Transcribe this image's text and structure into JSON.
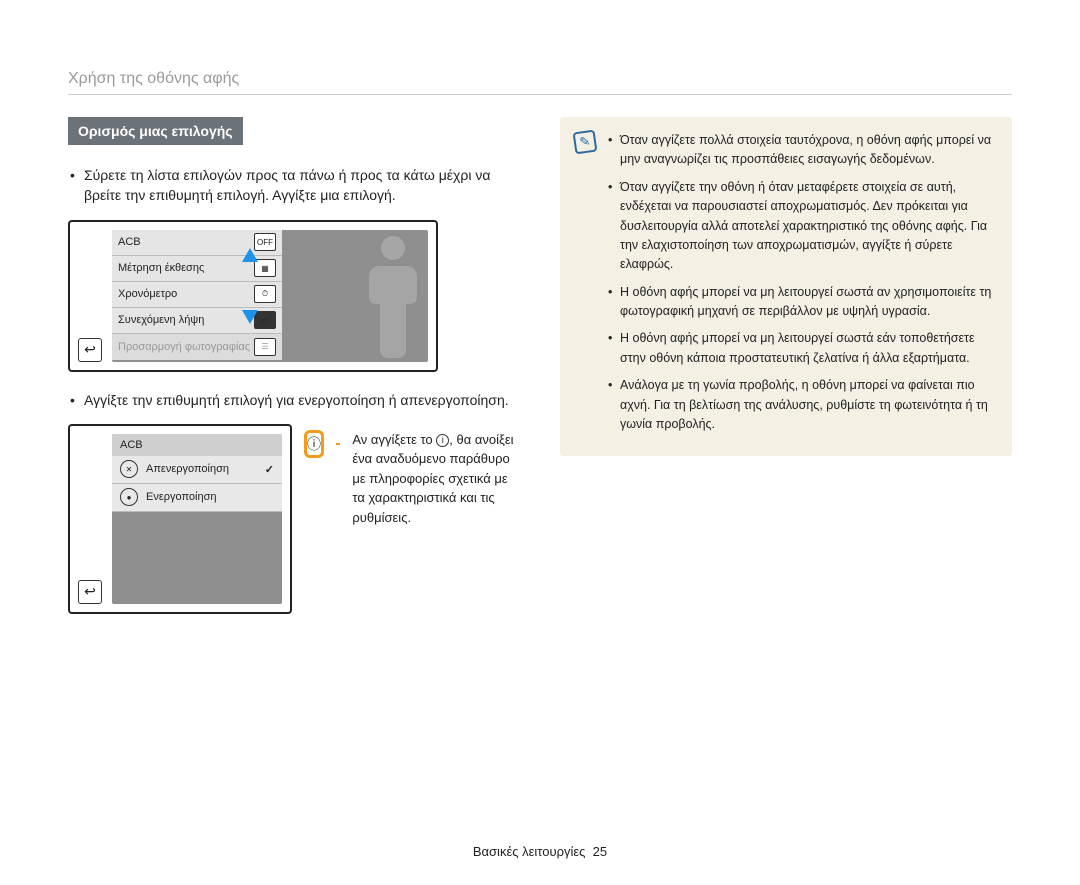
{
  "header": {
    "title": "Χρήση της οθόνης αφής"
  },
  "section": {
    "heading": "Ορισμός μιας επιλογής"
  },
  "paragraphs": {
    "scroll": "Σύρετε τη λίστα επιλογών προς τα πάνω ή προς τα κάτω μέχρι να βρείτε την επιθυμητή επιλογή. Αγγίξτε μια επιλογή.",
    "select": "Αγγίξτε την επιθυμητή επιλογή για ενεργοποίηση ή απενεργοποίηση."
  },
  "camera1": {
    "items": [
      "ACB",
      "Μέτρηση έκθεσης",
      "Χρονόμετρο",
      "Συνεχόμενη λήψη",
      "Προσαρμογή φωτογραφίας"
    ]
  },
  "camera2": {
    "head": "ACB",
    "off": "Απενεργοποίηση",
    "on": "Ενεργοποίηση"
  },
  "info": {
    "text": "Αν αγγίξετε το        , θα ανοίξει ένα αναδυόμενο παράθυρο με πληροφορίες σχετικά με τα χαρακτηριστικά και τις ρυθμίσεις.",
    "text_prefix": "Αν αγγίξετε το ",
    "text_suffix": ", θα ανοίξει ένα αναδυόμενο παράθυρο με πληροφορίες σχετικά με τα χαρακτηριστικά και τις ρυθμίσεις."
  },
  "notes": [
    "Όταν αγγίζετε πολλά στοιχεία ταυτόχρονα, η οθόνη αφής μπορεί να μην αναγνωρίζει τις προσπάθειες εισαγωγής δεδομένων.",
    "Όταν αγγίζετε την οθόνη ή όταν μεταφέρετε στοιχεία σε αυτή, ενδέχεται να παρουσιαστεί αποχρωματισμός. Δεν πρόκειται για δυσλειτουργία αλλά αποτελεί χαρακτηριστικό της οθόνης αφής. Για την ελαχιστοποίηση των αποχρωματισμών, αγγίξτε ή σύρετε ελαφρώς.",
    "Η οθόνη αφής μπορεί να μη λειτουργεί σωστά αν χρησιμοποιείτε τη φωτογραφική μηχανή σε περιβάλλον με υψηλή υγρασία.",
    "Η οθόνη αφής μπορεί να μη λειτουργεί σωστά εάν τοποθετήσετε στην οθόνη κάποια προστατευτική ζελατίνα ή άλλα εξαρτήματα.",
    "Ανάλογα με τη γωνία προβολής, η οθόνη μπορεί να φαίνεται πιο αχνή. Για τη βελτίωση της ανάλυσης, ρυθμίστε τη φωτεινότητα ή τη γωνία προβολής."
  ],
  "footer": {
    "chapter": "Βασικές λειτουργίες",
    "page": "25"
  }
}
